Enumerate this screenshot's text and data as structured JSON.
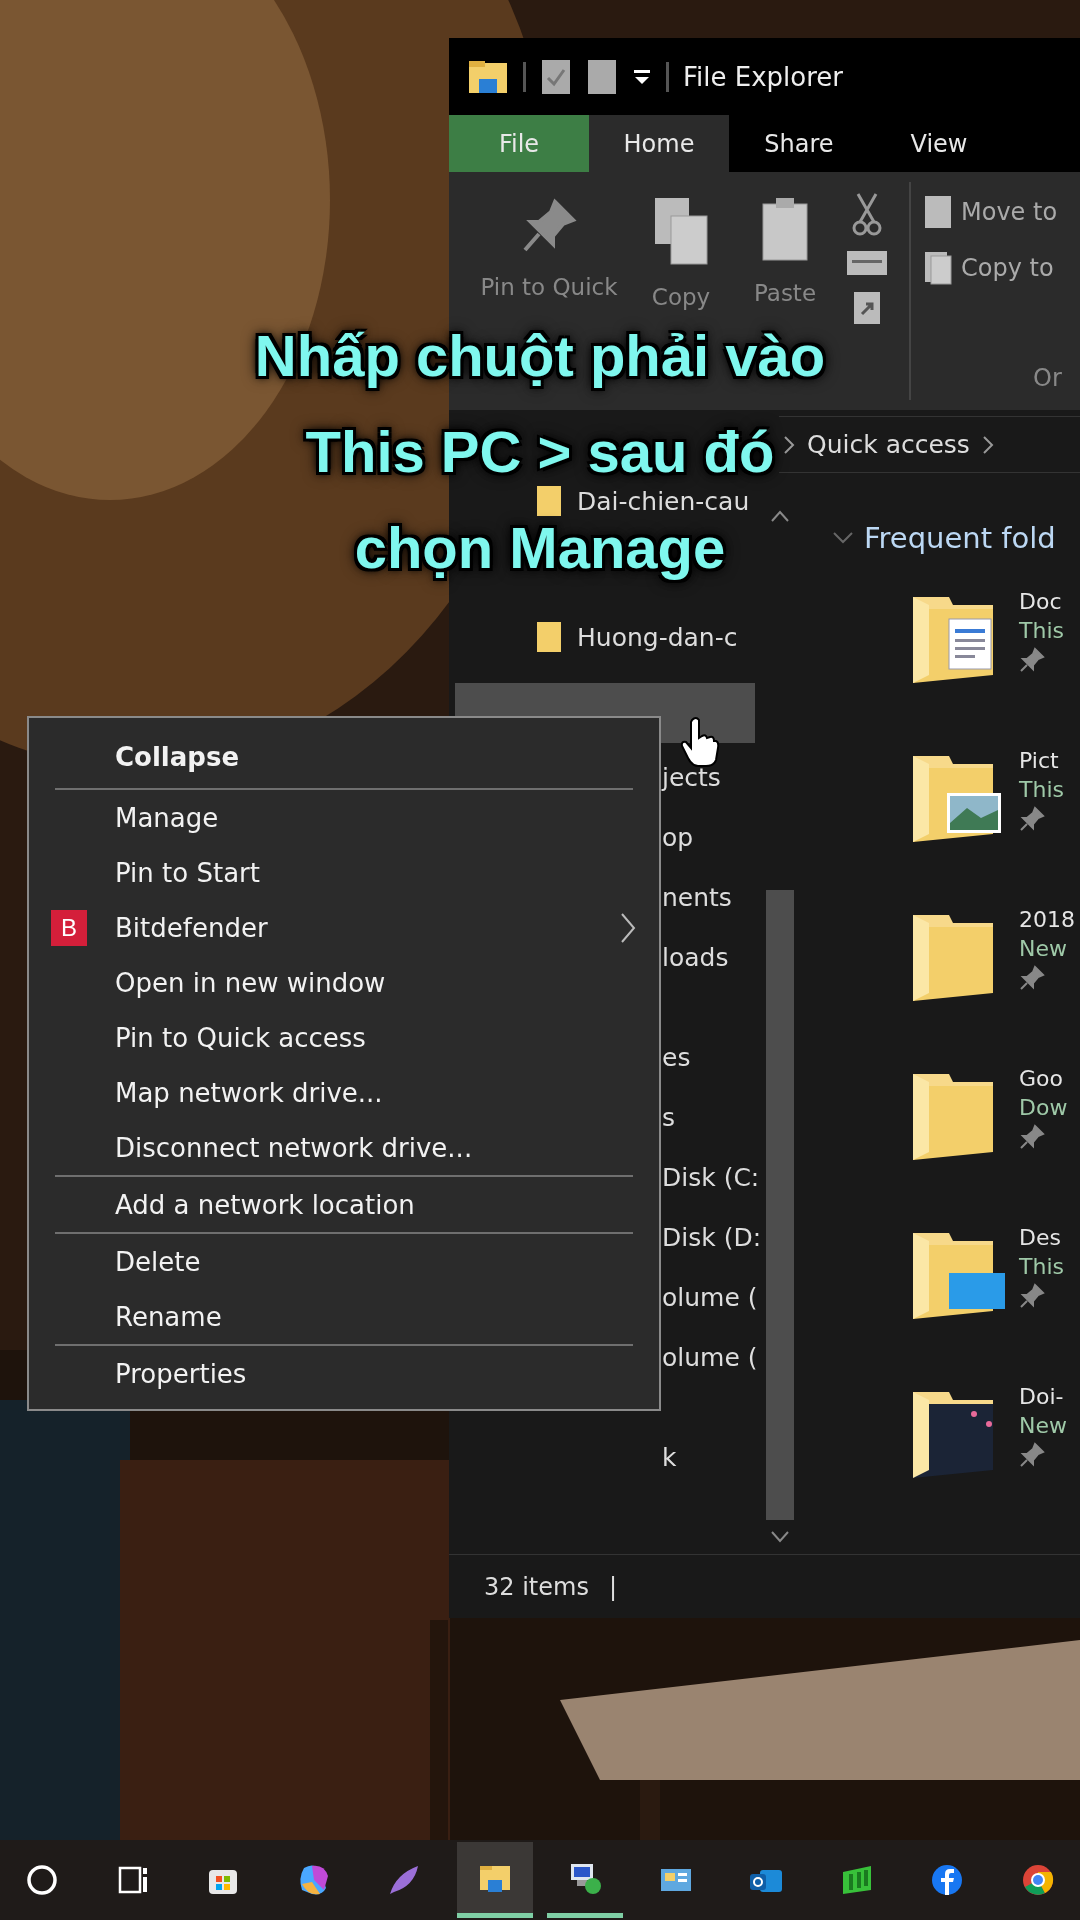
{
  "window": {
    "title": "File Explorer"
  },
  "tabs": [
    {
      "label": "File",
      "kind": "file",
      "selected": false
    },
    {
      "label": "Home",
      "kind": "tab",
      "selected": true
    },
    {
      "label": "Share",
      "kind": "tab",
      "selected": false
    },
    {
      "label": "View",
      "kind": "tab",
      "selected": false
    }
  ],
  "ribbon": {
    "clipboard": [
      {
        "label": "Pin to Quick",
        "kind": "pin"
      },
      {
        "label": "Copy",
        "kind": "copy"
      },
      {
        "label": "Paste",
        "kind": "paste"
      }
    ],
    "organize": [
      {
        "label": "Move to",
        "kind": "move"
      },
      {
        "label": "Copy to",
        "kind": "copyto"
      }
    ],
    "group_label": "Or"
  },
  "address": {
    "crumbs": [
      "Quick access"
    ]
  },
  "nav": {
    "items": [
      {
        "label": "Dai-chien-cau"
      },
      {
        "label": "Huong-dan-c"
      }
    ],
    "this_pc": {
      "selected": true,
      "expanded": true,
      "groups": [
        [
          "jects",
          "op",
          "nents",
          "loads"
        ],
        [
          "es",
          "s",
          "Disk (C:",
          "Disk (D:",
          "olume (",
          "olume ("
        ],
        [
          "k"
        ]
      ]
    }
  },
  "content": {
    "heading": "Frequent fold",
    "expanded": true,
    "items": [
      {
        "name": "Doc",
        "location": "This",
        "kind": "documents",
        "pinned": true
      },
      {
        "name": "Pict",
        "location": "This",
        "kind": "pictures",
        "pinned": true
      },
      {
        "name": "2018",
        "location": "New",
        "kind": "folder",
        "pinned": true
      },
      {
        "name": "Goo",
        "location": "Dow",
        "kind": "folder",
        "pinned": true
      },
      {
        "name": "Des",
        "location": "This",
        "kind": "desktop",
        "pinned": true
      },
      {
        "name": "Doi-",
        "location": "New",
        "kind": "dark",
        "pinned": true
      }
    ]
  },
  "status_bar": {
    "count": "32 items",
    "divider": "|"
  },
  "context_menu": {
    "groups": [
      [
        {
          "label": "Collapse",
          "default": true
        }
      ],
      [
        {
          "label": "Manage",
          "default": false
        },
        {
          "label": "Pin to Start",
          "default": false
        },
        {
          "label": "Bitdefender",
          "default": false,
          "kind": "app",
          "icon_text": "B",
          "submenu": true
        },
        {
          "label": "Open in new window",
          "default": false
        },
        {
          "label": "Pin to Quick access",
          "default": false
        },
        {
          "label": "Map network drive...",
          "default": false
        },
        {
          "label": "Disconnect network drive...",
          "default": false
        }
      ],
      [
        {
          "label": "Add a network location",
          "default": false
        }
      ],
      [
        {
          "label": "Delete",
          "default": false
        },
        {
          "label": "Rename",
          "default": false
        }
      ],
      [
        {
          "label": "Properties",
          "default": false
        }
      ]
    ]
  },
  "caption": [
    "Nhấp chuột phải vào",
    "This PC > sau đó",
    "chọn Manage"
  ],
  "taskbar": [
    {
      "kind": "search",
      "active": false,
      "running": false
    },
    {
      "kind": "taskview",
      "active": false,
      "running": false
    },
    {
      "kind": "store",
      "active": false,
      "running": false
    },
    {
      "kind": "copilot",
      "active": false,
      "running": false
    },
    {
      "kind": "feather",
      "active": false,
      "running": false
    },
    {
      "kind": "explorer",
      "active": true,
      "running": true
    },
    {
      "kind": "remote",
      "active": false,
      "running": true
    },
    {
      "kind": "panel",
      "active": false,
      "running": false
    },
    {
      "kind": "outlook",
      "active": false,
      "running": false
    },
    {
      "kind": "chart",
      "active": false,
      "running": false
    },
    {
      "kind": "facebook",
      "active": false,
      "running": false
    },
    {
      "kind": "chrome",
      "active": false,
      "running": false
    }
  ]
}
